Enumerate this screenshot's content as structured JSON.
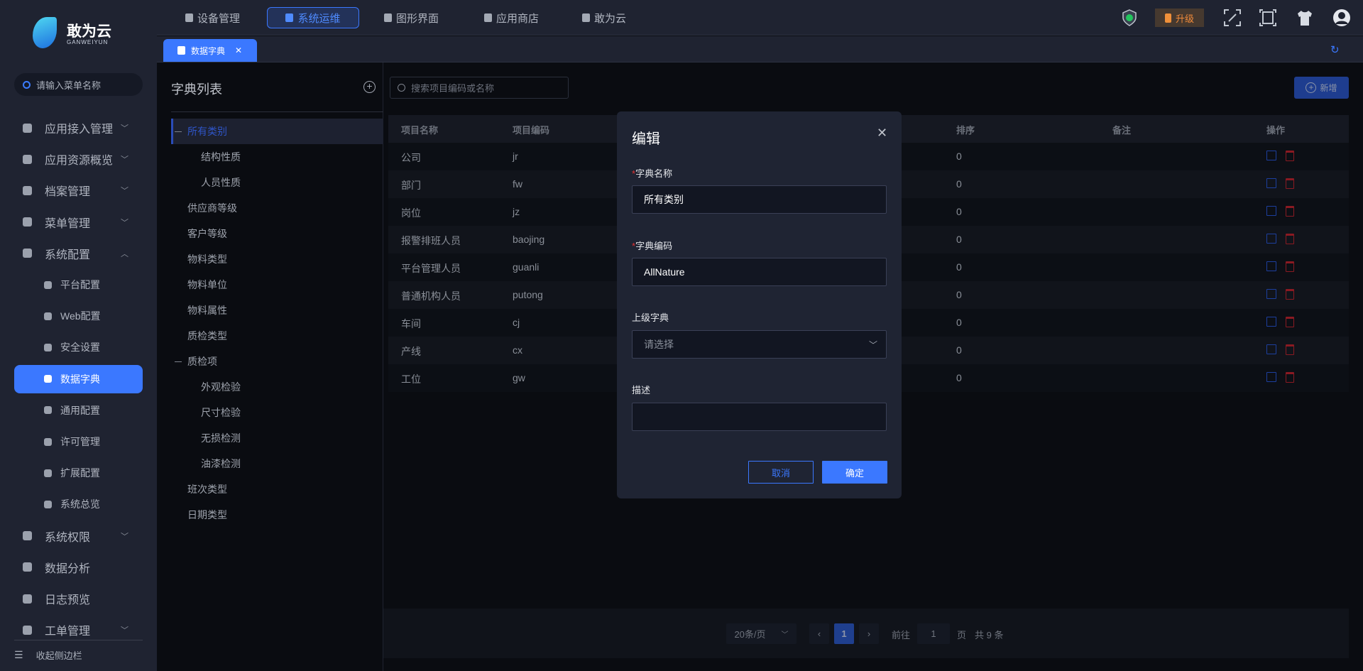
{
  "app": {
    "logo_name": "敢为云",
    "logo_sub": "GANWEIYUN"
  },
  "sidebar": {
    "search_placeholder": "请输入菜单名称",
    "items": [
      {
        "label": "应用接入管理",
        "icon": "home-icon",
        "chevron": "down"
      },
      {
        "label": "应用资源概览",
        "icon": "layers-icon",
        "chevron": "down"
      },
      {
        "label": "档案管理",
        "icon": "archive-icon",
        "chevron": "down"
      },
      {
        "label": "菜单管理",
        "icon": "layout-icon",
        "chevron": "down"
      },
      {
        "label": "系统配置",
        "icon": "home-icon",
        "chevron": "up"
      },
      {
        "label": "平台配置",
        "icon": "camera-icon",
        "sub": true
      },
      {
        "label": "Web配置",
        "icon": "monitor-icon",
        "sub": true
      },
      {
        "label": "安全设置",
        "icon": "shield-icon",
        "sub": true
      },
      {
        "label": "数据字典",
        "icon": "book-icon",
        "sub": true,
        "active": true
      },
      {
        "label": "通用配置",
        "icon": "grid-icon",
        "sub": true
      },
      {
        "label": "许可管理",
        "icon": "stamp-icon",
        "sub": true
      },
      {
        "label": "扩展配置",
        "icon": "puzzle-icon",
        "sub": true
      },
      {
        "label": "系统总览",
        "icon": "home-icon",
        "sub": true
      },
      {
        "label": "系统权限",
        "icon": "shield-lock-icon",
        "chevron": "down"
      },
      {
        "label": "数据分析",
        "icon": "pie-chart-icon"
      },
      {
        "label": "日志预览",
        "icon": "document-icon"
      },
      {
        "label": "工单管理",
        "icon": "gear-icon",
        "chevron": "down"
      }
    ],
    "collapse_label": "收起侧边栏"
  },
  "topnav": {
    "items": [
      {
        "label": "设备管理",
        "icon": "device-icon"
      },
      {
        "label": "系统运维",
        "icon": "wrench-icon",
        "active": true
      },
      {
        "label": "图形界面",
        "icon": "monitor-icon"
      },
      {
        "label": "应用商店",
        "icon": "store-icon"
      },
      {
        "label": "敢为云",
        "icon": "butterfly-icon"
      }
    ],
    "upgrade_label": "升级"
  },
  "tabs": [
    {
      "label": "数据字典",
      "close": "✕"
    }
  ],
  "dict_panel": {
    "title": "字典列表",
    "tree": [
      {
        "label": "所有类别",
        "level": 0,
        "expanded": true,
        "selected": true
      },
      {
        "label": "结构性质",
        "level": 1
      },
      {
        "label": "人员性质",
        "level": 1
      },
      {
        "label": "供应商等级",
        "level": 0
      },
      {
        "label": "客户等级",
        "level": 0
      },
      {
        "label": "物料类型",
        "level": 0
      },
      {
        "label": "物料单位",
        "level": 0
      },
      {
        "label": "物料属性",
        "level": 0
      },
      {
        "label": "质检类型",
        "level": 0
      },
      {
        "label": "质检项",
        "level": 0,
        "expanded": true
      },
      {
        "label": "外观检验",
        "level": 1
      },
      {
        "label": "尺寸检验",
        "level": 1
      },
      {
        "label": "无损检测",
        "level": 1
      },
      {
        "label": "油漆检测",
        "level": 1
      },
      {
        "label": "班次类型",
        "level": 0
      },
      {
        "label": "日期类型",
        "level": 0
      }
    ]
  },
  "main": {
    "search_placeholder": "搜索项目编码或名称",
    "add_label": "新增",
    "columns": [
      "项目名称",
      "项目编码",
      "排序",
      "备注",
      "操作"
    ],
    "rows": [
      {
        "name": "公司",
        "code": "jr",
        "sort": "0",
        "remark": ""
      },
      {
        "name": "部门",
        "code": "fw",
        "sort": "0",
        "remark": ""
      },
      {
        "name": "岗位",
        "code": "jz",
        "sort": "0",
        "remark": ""
      },
      {
        "name": "报警排班人员",
        "code": "baojing",
        "sort": "0",
        "remark": ""
      },
      {
        "name": "平台管理人员",
        "code": "guanli",
        "sort": "0",
        "remark": ""
      },
      {
        "name": "普通机构人员",
        "code": "putong",
        "sort": "0",
        "remark": ""
      },
      {
        "name": "车间",
        "code": "cj",
        "sort": "0",
        "remark": ""
      },
      {
        "name": "产线",
        "code": "cx",
        "sort": "0",
        "remark": ""
      },
      {
        "name": "工位",
        "code": "gw",
        "sort": "0",
        "remark": ""
      }
    ],
    "pagination": {
      "page_size": "20条/页",
      "current": "1",
      "goto_label": "前往",
      "goto_value": "1",
      "page_suffix": "页",
      "total": "共 9 条"
    }
  },
  "dialog": {
    "title": "编辑",
    "close": "✕",
    "fields": [
      {
        "label": "字典名称",
        "required": true,
        "value": "所有类别"
      },
      {
        "label": "字典编码",
        "required": true,
        "value": "AllNature"
      },
      {
        "label": "上级字典",
        "required": false,
        "placeholder": "请选择"
      },
      {
        "label": "描述",
        "required": false,
        "value": ""
      }
    ],
    "cancel_label": "取消",
    "ok_label": "确定"
  },
  "colors": {
    "accent": "#3b78ff",
    "danger": "#8a1a22",
    "upgrade": "#f08a3a"
  }
}
